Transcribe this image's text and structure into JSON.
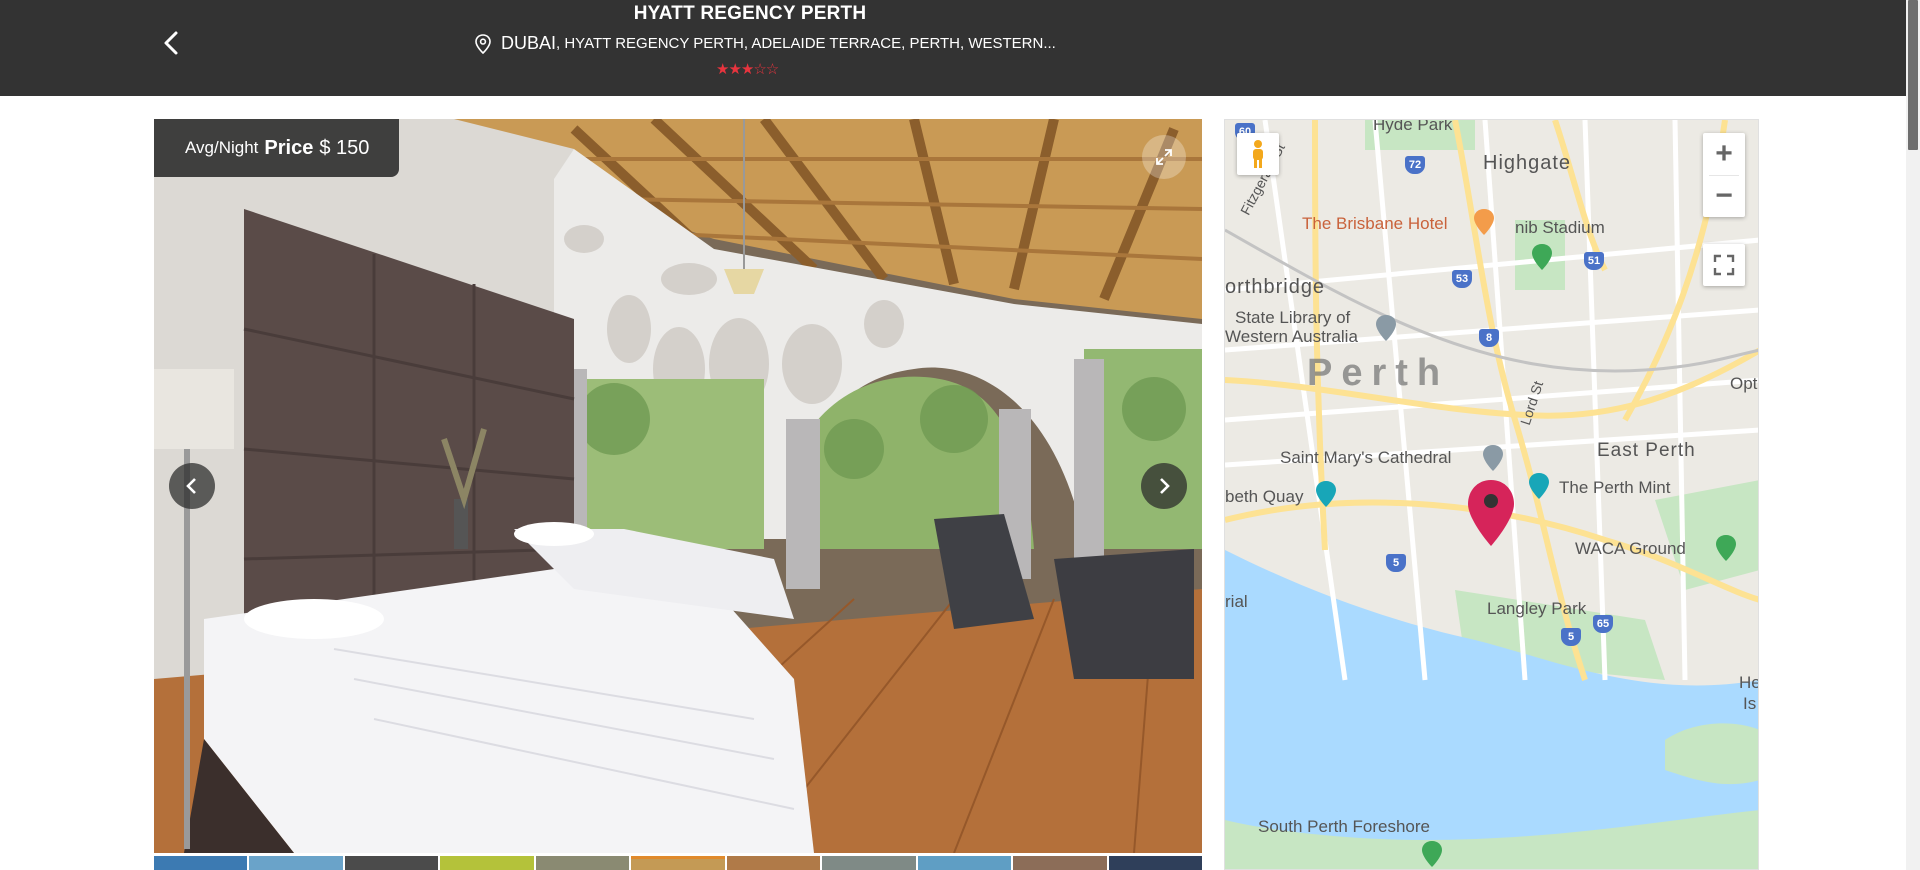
{
  "header": {
    "title": "HYATT REGENCY PERTH",
    "city": "DUBAI",
    "address": " , HYATT REGENCY PERTH, ADELAIDE TERRACE, PERTH, WESTERN...",
    "stars": "★★★☆☆",
    "rating": 3,
    "rating_max": 5,
    "star_color": "#e8343e"
  },
  "gallery": {
    "price_label": "Avg/Night",
    "price_word": "Price",
    "price_value": "$ 150",
    "prev_icon": "chevron-left-icon",
    "next_icon": "chevron-right-icon",
    "expand_icon": "expand-icon"
  },
  "map": {
    "zoom_in": "+",
    "zoom_out": "−",
    "labels": {
      "hyde_park": "Hyde Park",
      "highgate": "Highgate",
      "fitzgerald": "Fitzgerald St",
      "brisbane": "The Brisbane Hotel",
      "nib": "nib Stadium",
      "northbridge": "orthbridge",
      "library1": "State Library of",
      "library2": "Western Australia",
      "perth": "Perth",
      "lord": "Lord St",
      "opt": "Opt",
      "east_perth": "East Perth",
      "cathedral": "Saint Mary's Cathedral",
      "mint": "The Perth Mint",
      "quay": "beth Quay",
      "waca": "WACA Ground",
      "rial": "rial",
      "langley": "Langley Park",
      "hei": "Hei",
      "is": "Is",
      "south_perth": "South Perth Foreshore"
    },
    "shields": [
      "60",
      "72",
      "53",
      "51",
      "8",
      "5",
      "5",
      "65"
    ]
  },
  "colors": {
    "header_bg": "#333333",
    "accent_red": "#e8343e",
    "marker": "#d6245a",
    "water": "#aadaff",
    "road": "#fde293"
  }
}
